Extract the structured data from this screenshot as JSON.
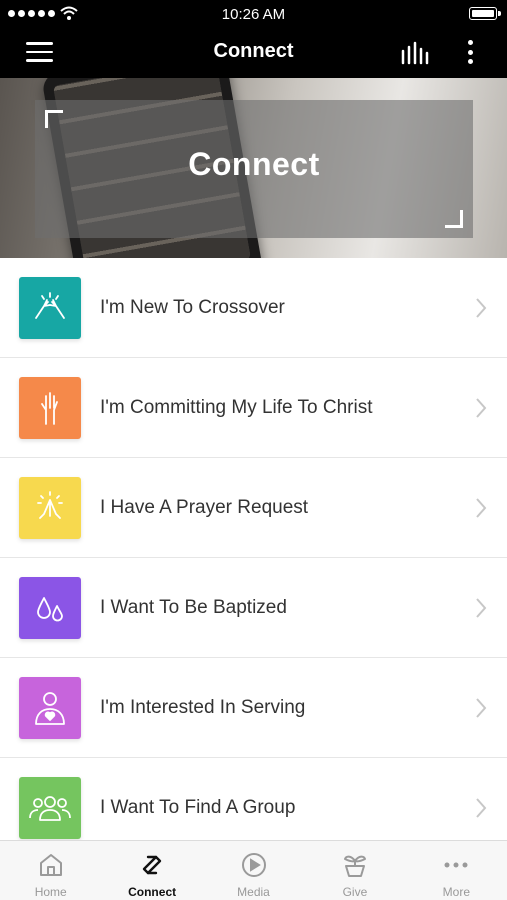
{
  "status_bar": {
    "time": "10:26 AM"
  },
  "nav": {
    "title": "Connect"
  },
  "hero": {
    "label": "Connect"
  },
  "items": [
    {
      "label": "I'm New To Crossover",
      "icon": "high-five-icon",
      "color": "#17a7a4"
    },
    {
      "label": "I'm Committing My Life To Christ",
      "icon": "raised-hand-icon",
      "color": "#f5894a"
    },
    {
      "label": "I Have A Prayer Request",
      "icon": "praying-hands-icon",
      "color": "#f7d94e"
    },
    {
      "label": "I Want To Be Baptized",
      "icon": "water-drops-icon",
      "color": "#8b55e6"
    },
    {
      "label": "I'm Interested In Serving",
      "icon": "person-heart-icon",
      "color": "#c764dc"
    },
    {
      "label": "I Want To Find A Group",
      "icon": "group-icon",
      "color": "#75c55f"
    }
  ],
  "tabs": [
    {
      "label": "Home",
      "icon": "home-icon"
    },
    {
      "label": "Connect",
      "icon": "connect-icon",
      "active": true
    },
    {
      "label": "Media",
      "icon": "play-circle-icon"
    },
    {
      "label": "Give",
      "icon": "plant-icon"
    },
    {
      "label": "More",
      "icon": "more-dots-icon"
    }
  ]
}
